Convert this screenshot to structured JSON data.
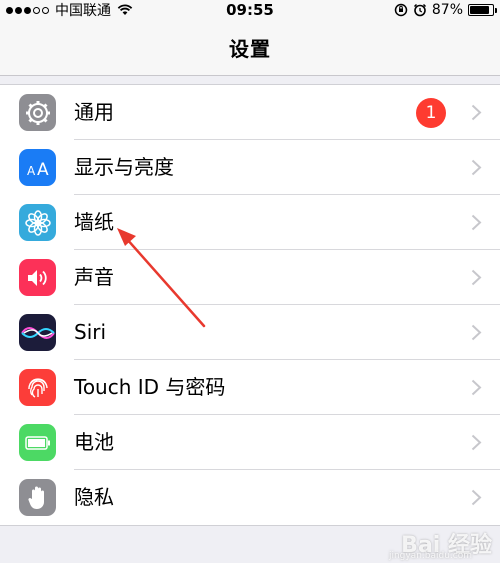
{
  "status_bar": {
    "carrier": "中国联通",
    "time": "09:55",
    "battery_percent": "87%",
    "battery_level": 0.87,
    "signal_strength": 3
  },
  "nav": {
    "title": "设置"
  },
  "settings": {
    "items": [
      {
        "label": "通用",
        "icon": "gear-icon",
        "color": "#8e8e93",
        "badge": "1"
      },
      {
        "label": "显示与亮度",
        "icon": "text-size-icon",
        "color": "#1a7cf5"
      },
      {
        "label": "墙纸",
        "icon": "flower-icon",
        "color": "#35aadc"
      },
      {
        "label": "声音",
        "icon": "speaker-icon",
        "color": "#fc3158"
      },
      {
        "label": "Siri",
        "icon": "siri-icon",
        "color": "#1c1c3a"
      },
      {
        "label": "Touch ID 与密码",
        "icon": "fingerprint-icon",
        "color": "#fc3d39"
      },
      {
        "label": "电池",
        "icon": "battery-icon",
        "color": "#4cd964"
      },
      {
        "label": "隐私",
        "icon": "hand-icon",
        "color": "#8e8e93"
      }
    ]
  },
  "colors": {
    "badge": "#fe3b30",
    "annotation_arrow": "#e8392e",
    "background": "#efeff4"
  },
  "watermark": {
    "text": "Bai 经验",
    "sub": "jingyan.baidu.com"
  }
}
